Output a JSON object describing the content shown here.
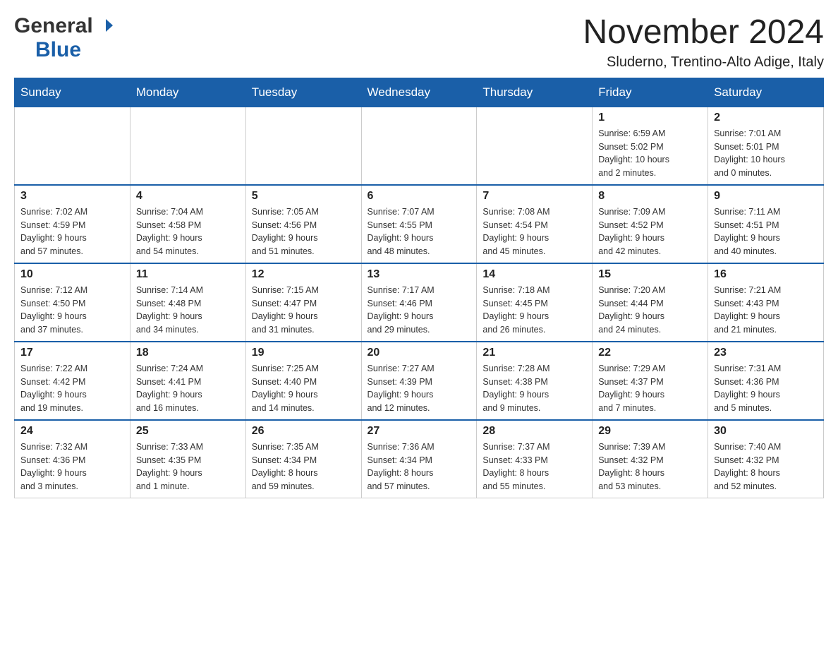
{
  "header": {
    "logo_general": "General",
    "logo_blue": "Blue",
    "month_title": "November 2024",
    "location": "Sluderno, Trentino-Alto Adige, Italy"
  },
  "weekdays": [
    "Sunday",
    "Monday",
    "Tuesday",
    "Wednesday",
    "Thursday",
    "Friday",
    "Saturday"
  ],
  "weeks": [
    [
      {
        "day": "",
        "info": ""
      },
      {
        "day": "",
        "info": ""
      },
      {
        "day": "",
        "info": ""
      },
      {
        "day": "",
        "info": ""
      },
      {
        "day": "",
        "info": ""
      },
      {
        "day": "1",
        "info": "Sunrise: 6:59 AM\nSunset: 5:02 PM\nDaylight: 10 hours\nand 2 minutes."
      },
      {
        "day": "2",
        "info": "Sunrise: 7:01 AM\nSunset: 5:01 PM\nDaylight: 10 hours\nand 0 minutes."
      }
    ],
    [
      {
        "day": "3",
        "info": "Sunrise: 7:02 AM\nSunset: 4:59 PM\nDaylight: 9 hours\nand 57 minutes."
      },
      {
        "day": "4",
        "info": "Sunrise: 7:04 AM\nSunset: 4:58 PM\nDaylight: 9 hours\nand 54 minutes."
      },
      {
        "day": "5",
        "info": "Sunrise: 7:05 AM\nSunset: 4:56 PM\nDaylight: 9 hours\nand 51 minutes."
      },
      {
        "day": "6",
        "info": "Sunrise: 7:07 AM\nSunset: 4:55 PM\nDaylight: 9 hours\nand 48 minutes."
      },
      {
        "day": "7",
        "info": "Sunrise: 7:08 AM\nSunset: 4:54 PM\nDaylight: 9 hours\nand 45 minutes."
      },
      {
        "day": "8",
        "info": "Sunrise: 7:09 AM\nSunset: 4:52 PM\nDaylight: 9 hours\nand 42 minutes."
      },
      {
        "day": "9",
        "info": "Sunrise: 7:11 AM\nSunset: 4:51 PM\nDaylight: 9 hours\nand 40 minutes."
      }
    ],
    [
      {
        "day": "10",
        "info": "Sunrise: 7:12 AM\nSunset: 4:50 PM\nDaylight: 9 hours\nand 37 minutes."
      },
      {
        "day": "11",
        "info": "Sunrise: 7:14 AM\nSunset: 4:48 PM\nDaylight: 9 hours\nand 34 minutes."
      },
      {
        "day": "12",
        "info": "Sunrise: 7:15 AM\nSunset: 4:47 PM\nDaylight: 9 hours\nand 31 minutes."
      },
      {
        "day": "13",
        "info": "Sunrise: 7:17 AM\nSunset: 4:46 PM\nDaylight: 9 hours\nand 29 minutes."
      },
      {
        "day": "14",
        "info": "Sunrise: 7:18 AM\nSunset: 4:45 PM\nDaylight: 9 hours\nand 26 minutes."
      },
      {
        "day": "15",
        "info": "Sunrise: 7:20 AM\nSunset: 4:44 PM\nDaylight: 9 hours\nand 24 minutes."
      },
      {
        "day": "16",
        "info": "Sunrise: 7:21 AM\nSunset: 4:43 PM\nDaylight: 9 hours\nand 21 minutes."
      }
    ],
    [
      {
        "day": "17",
        "info": "Sunrise: 7:22 AM\nSunset: 4:42 PM\nDaylight: 9 hours\nand 19 minutes."
      },
      {
        "day": "18",
        "info": "Sunrise: 7:24 AM\nSunset: 4:41 PM\nDaylight: 9 hours\nand 16 minutes."
      },
      {
        "day": "19",
        "info": "Sunrise: 7:25 AM\nSunset: 4:40 PM\nDaylight: 9 hours\nand 14 minutes."
      },
      {
        "day": "20",
        "info": "Sunrise: 7:27 AM\nSunset: 4:39 PM\nDaylight: 9 hours\nand 12 minutes."
      },
      {
        "day": "21",
        "info": "Sunrise: 7:28 AM\nSunset: 4:38 PM\nDaylight: 9 hours\nand 9 minutes."
      },
      {
        "day": "22",
        "info": "Sunrise: 7:29 AM\nSunset: 4:37 PM\nDaylight: 9 hours\nand 7 minutes."
      },
      {
        "day": "23",
        "info": "Sunrise: 7:31 AM\nSunset: 4:36 PM\nDaylight: 9 hours\nand 5 minutes."
      }
    ],
    [
      {
        "day": "24",
        "info": "Sunrise: 7:32 AM\nSunset: 4:36 PM\nDaylight: 9 hours\nand 3 minutes."
      },
      {
        "day": "25",
        "info": "Sunrise: 7:33 AM\nSunset: 4:35 PM\nDaylight: 9 hours\nand 1 minute."
      },
      {
        "day": "26",
        "info": "Sunrise: 7:35 AM\nSunset: 4:34 PM\nDaylight: 8 hours\nand 59 minutes."
      },
      {
        "day": "27",
        "info": "Sunrise: 7:36 AM\nSunset: 4:34 PM\nDaylight: 8 hours\nand 57 minutes."
      },
      {
        "day": "28",
        "info": "Sunrise: 7:37 AM\nSunset: 4:33 PM\nDaylight: 8 hours\nand 55 minutes."
      },
      {
        "day": "29",
        "info": "Sunrise: 7:39 AM\nSunset: 4:32 PM\nDaylight: 8 hours\nand 53 minutes."
      },
      {
        "day": "30",
        "info": "Sunrise: 7:40 AM\nSunset: 4:32 PM\nDaylight: 8 hours\nand 52 minutes."
      }
    ]
  ]
}
